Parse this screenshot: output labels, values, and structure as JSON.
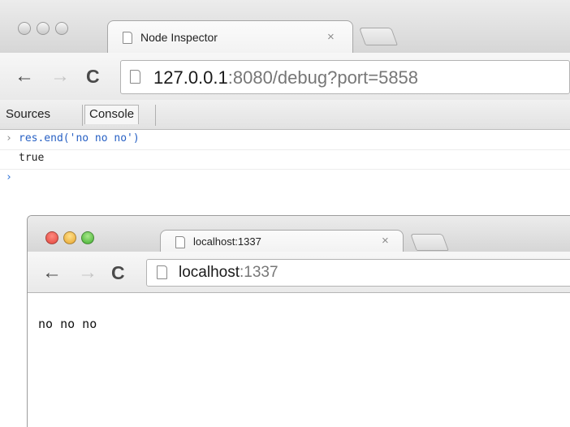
{
  "back_window": {
    "tab_title": "Node Inspector",
    "tab_close": "×",
    "url_host": "127.0.0.1",
    "url_rest": ":8080/debug?port=5858",
    "nav": {
      "back": "←",
      "forward": "→",
      "reload": "C"
    }
  },
  "devtools": {
    "tabs": [
      {
        "label": "Sources"
      },
      {
        "label": "Console",
        "selected": true
      }
    ],
    "console": {
      "lines": [
        {
          "prompt": "›",
          "text": "res.end('no no no')"
        },
        {
          "prompt": "",
          "text": "true"
        },
        {
          "prompt": "›",
          "text": ""
        }
      ]
    }
  },
  "front_window": {
    "tab_title": "localhost:1337",
    "tab_close": "×",
    "url_host": "localhost",
    "url_rest": ":1337",
    "nav": {
      "back": "←",
      "forward": "→",
      "reload": "C"
    },
    "page_text": "no no no"
  },
  "colors": {
    "command_blue": "#2861c4",
    "traffic_red": "#e2453c",
    "traffic_yellow": "#e7a42c",
    "traffic_green": "#3fae2e"
  }
}
